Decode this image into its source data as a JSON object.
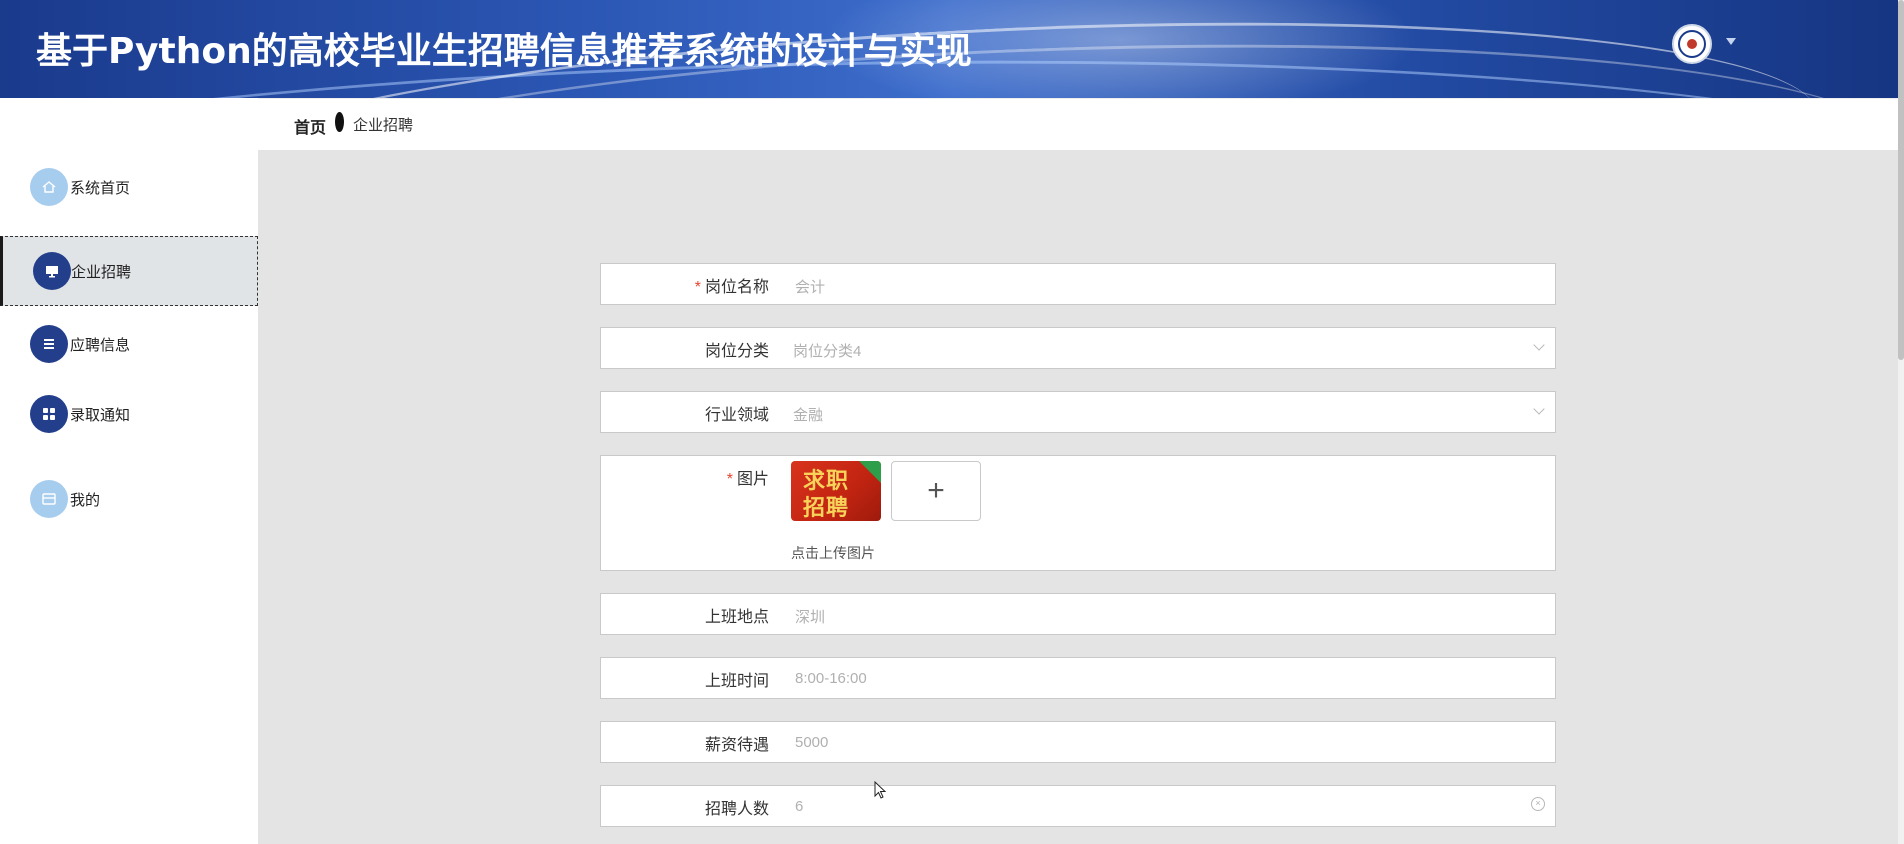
{
  "header": {
    "title": "基于Python的高校毕业生招聘信息推荐系统的设计与实现"
  },
  "sidebar": {
    "items": [
      {
        "label": "系统首页",
        "icon": "home-icon"
      },
      {
        "label": "企业招聘",
        "icon": "monitor-icon",
        "active": true
      },
      {
        "label": "应聘信息",
        "icon": "list-icon"
      },
      {
        "label": "录取通知",
        "icon": "grid-icon"
      },
      {
        "label": "我的",
        "icon": "card-icon"
      }
    ]
  },
  "breadcrumb": {
    "home": "首页",
    "current": "企业招聘"
  },
  "form": {
    "job_name": {
      "label": "岗位名称",
      "required": true,
      "value": "会计"
    },
    "job_category": {
      "label": "岗位分类",
      "value": "岗位分类4"
    },
    "industry": {
      "label": "行业领域",
      "value": "金融"
    },
    "image": {
      "label": "图片",
      "required": true,
      "thumb_line1": "求职",
      "thumb_line2": "招聘",
      "upload_hint": "点击上传图片",
      "add_symbol": "+"
    },
    "location": {
      "label": "上班地点",
      "value": "深圳"
    },
    "work_time": {
      "label": "上班时间",
      "value": "8:00-16:00"
    },
    "salary": {
      "label": "薪资待遇",
      "value": "5000"
    },
    "headcount": {
      "label": "招聘人数",
      "value": "6"
    }
  },
  "colors": {
    "header_blue": "#1a3a8c",
    "required_star": "#e8442d",
    "icon_dark": "#233f8c",
    "icon_light": "#a7cdee"
  }
}
